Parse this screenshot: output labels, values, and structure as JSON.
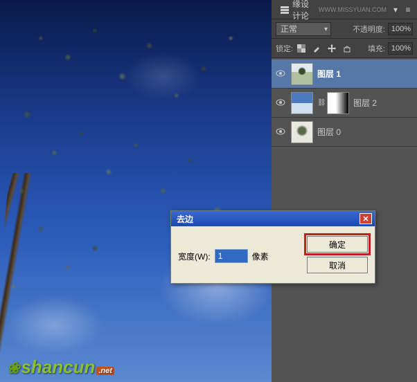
{
  "panel": {
    "tab_label": "类 思缘设计论坛",
    "url": "WWW.MISSYUAN.COM",
    "blend_mode": "正常",
    "opacity_label": "不透明度:",
    "opacity_value": "100%",
    "lock_label": "锁定:",
    "fill_label": "填充:",
    "fill_value": "100%"
  },
  "layers": [
    {
      "name": "图层 1",
      "visible": true,
      "selected": true
    },
    {
      "name": "图层 2",
      "visible": true,
      "selected": false
    },
    {
      "name": "图层 0",
      "visible": true,
      "selected": false
    }
  ],
  "dialog": {
    "title": "去边",
    "width_label": "宽度(W):",
    "width_value": "1",
    "unit": "像素",
    "ok": "确定",
    "cancel": "取消"
  },
  "watermark": {
    "text": "shancun",
    "badge": ".net"
  }
}
